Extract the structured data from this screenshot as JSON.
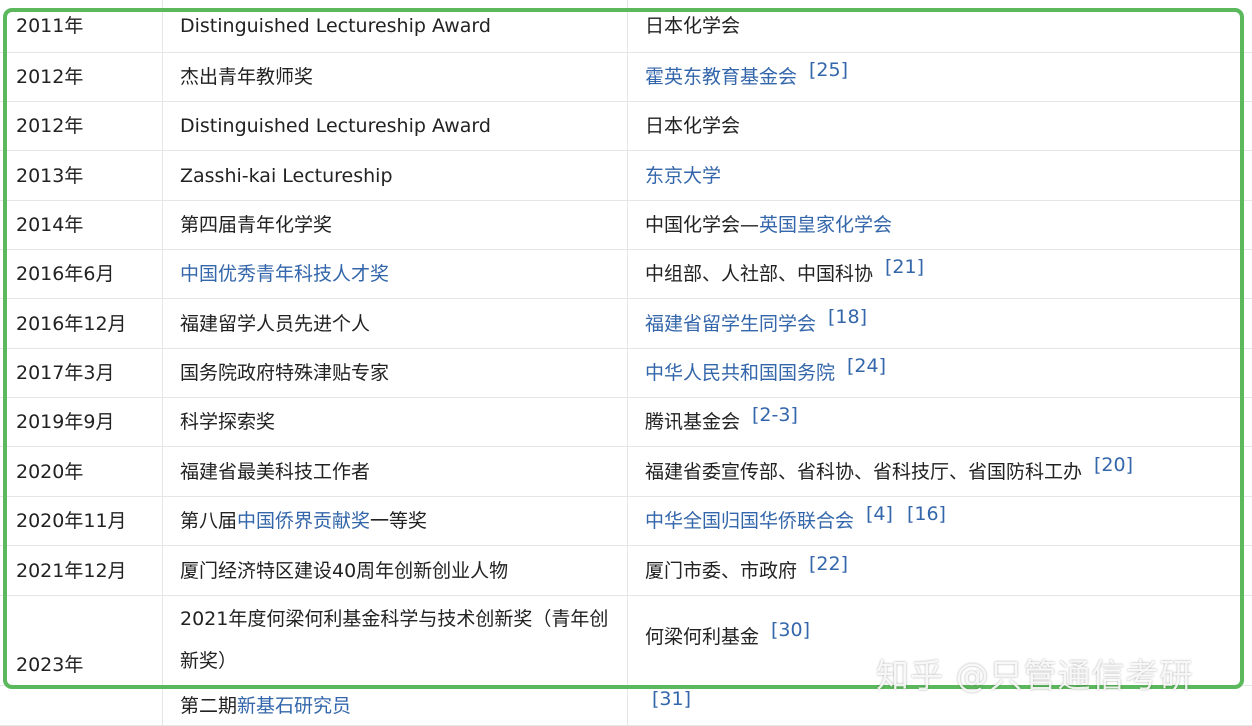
{
  "rows": [
    {
      "year": "2011年",
      "award": [
        {
          "text": "Distinguished Lectureship Award"
        }
      ],
      "org": [
        {
          "text": "日本化学会"
        }
      ],
      "refs": []
    },
    {
      "year": "2012年",
      "award": [
        {
          "text": "杰出青年教师奖"
        }
      ],
      "org": [
        {
          "text": "霍英东教育基金会",
          "link": true
        }
      ],
      "refs": [
        "[25]"
      ]
    },
    {
      "year": "2012年",
      "award": [
        {
          "text": "Distinguished Lectureship Award"
        }
      ],
      "org": [
        {
          "text": "日本化学会"
        }
      ],
      "refs": []
    },
    {
      "year": "2013年",
      "award": [
        {
          "text": "Zasshi-kai Lectureship"
        }
      ],
      "org": [
        {
          "text": "东京大学",
          "link": true
        }
      ],
      "refs": []
    },
    {
      "year": "2014年",
      "award": [
        {
          "text": "第四届青年化学奖"
        }
      ],
      "org": [
        {
          "text": "中国化学会—"
        },
        {
          "text": "英国皇家化学会",
          "link": true
        }
      ],
      "refs": []
    },
    {
      "year": "2016年6月",
      "award": [
        {
          "text": "中国优秀青年科技人才奖",
          "link": true
        }
      ],
      "org": [
        {
          "text": "中组部、人社部、中国科协"
        }
      ],
      "refs": [
        "[21]"
      ]
    },
    {
      "year": "2016年12月",
      "award": [
        {
          "text": "福建留学人员先进个人"
        }
      ],
      "org": [
        {
          "text": "福建省留学生同学会",
          "link": true
        }
      ],
      "refs": [
        "[18]"
      ]
    },
    {
      "year": "2017年3月",
      "award": [
        {
          "text": "国务院政府特殊津贴专家"
        }
      ],
      "org": [
        {
          "text": "中华人民共和国国务院",
          "link": true
        }
      ],
      "refs": [
        "[24]"
      ]
    },
    {
      "year": "2019年9月",
      "award": [
        {
          "text": "科学探索奖"
        }
      ],
      "org": [
        {
          "text": "腾讯基金会"
        }
      ],
      "refs": [
        "[2-3]"
      ]
    },
    {
      "year": "2020年",
      "award": [
        {
          "text": "福建省最美科技工作者"
        }
      ],
      "org": [
        {
          "text": "福建省委宣传部、省科协、省科技厅、省国防科工办"
        }
      ],
      "refs": [
        "[20]"
      ]
    },
    {
      "year": "2020年11月",
      "award": [
        {
          "text": "第八届"
        },
        {
          "text": "中国侨界贡献奖",
          "link": true
        },
        {
          "text": "一等奖"
        }
      ],
      "org": [
        {
          "text": "中华全国归国华侨联合会",
          "link": true
        }
      ],
      "refs": [
        "[4]",
        "[16]"
      ]
    },
    {
      "year": "2021年12月",
      "award": [
        {
          "text": "厦门经济特区建设40周年创新创业人物"
        }
      ],
      "org": [
        {
          "text": "厦门市委、市政府"
        }
      ],
      "refs": [
        "[22]"
      ]
    },
    {
      "year": "2023年",
      "award": [
        {
          "text": "2021年度何梁何利基金科学与技术创新奖（青年创新奖）"
        }
      ],
      "org": [
        {
          "text": "何梁何利基金"
        }
      ],
      "refs": [
        "[30]"
      ]
    },
    {
      "year": "",
      "award": [
        {
          "text": "第二期"
        },
        {
          "text": "新基石研究员",
          "link": true
        }
      ],
      "org": [],
      "refs": [
        "[31]"
      ]
    }
  ],
  "watermark": "知乎 @只管通信考研",
  "colors": {
    "link": "#3366aa",
    "highlight_border": "#5cb85c",
    "text": "#222222",
    "grid": "#e6e6e6"
  }
}
